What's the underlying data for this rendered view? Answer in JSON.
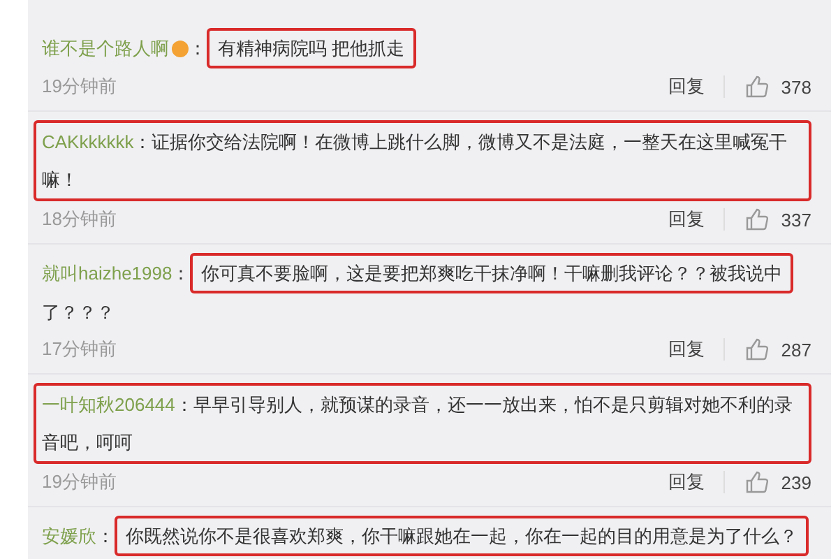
{
  "comments": [
    {
      "user": "谁不是个路人啊",
      "badge": true,
      "colon": "：",
      "lines": [
        "有精神病院吗  把他抓走"
      ],
      "whole_boxed": false,
      "text_boxed": true,
      "time": "19分钟前",
      "reply": "回复",
      "likes": "378"
    },
    {
      "user": "CAKkkkkkk",
      "colon": "：",
      "lines": [
        "证据你交给法院啊！在微博上跳什么脚，微博又不是法庭，一整天在这里喊冤干",
        "嘛！"
      ],
      "whole_boxed": true,
      "text_boxed": false,
      "time": "18分钟前",
      "reply": "回复",
      "likes": "337"
    },
    {
      "user": "就叫haizhe1998",
      "colon": "：",
      "lines": [
        "你可真不要脸啊，这是要把郑爽吃干抹净啊！干嘛删我评论？？被我说中",
        "了？？？"
      ],
      "whole_boxed": false,
      "text_boxed": true,
      "time": "17分钟前",
      "reply": "回复",
      "likes": "287"
    },
    {
      "user": "一叶知秋206444",
      "colon": "：",
      "lines": [
        "早早引导别人，就预谋的录音，还一一放出来，怕不是只剪辑对她不利的录",
        "音吧，呵呵"
      ],
      "whole_boxed": true,
      "text_boxed": false,
      "time": "19分钟前",
      "reply": "回复",
      "likes": "239"
    },
    {
      "user": "安媛欣",
      "colon": "：",
      "lines": [
        "你既然说你不是很喜欢郑爽，你干嘛跟她在一起，你在一起的目的用意是为了什么？"
      ],
      "whole_boxed": false,
      "text_boxed": true
    }
  ]
}
